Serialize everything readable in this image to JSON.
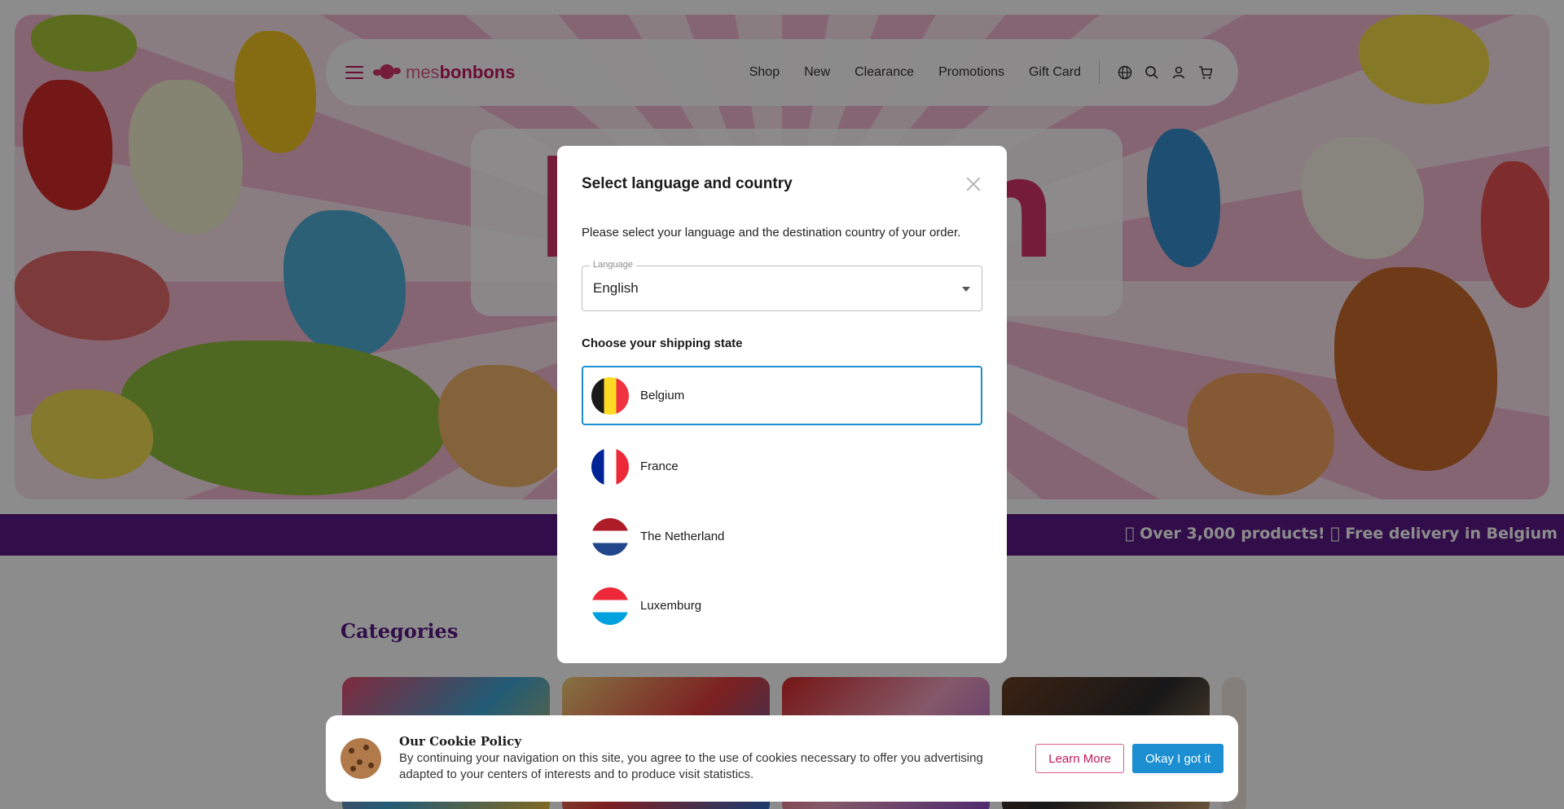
{
  "header": {
    "logo_prefix": "mes",
    "logo_suffix": "bonbons",
    "nav": [
      {
        "label": "Shop"
      },
      {
        "label": "New"
      },
      {
        "label": "Clearance"
      },
      {
        "label": "Promotions"
      },
      {
        "label": "Gift Card"
      }
    ],
    "icons": [
      "globe-icon",
      "search-icon",
      "user-icon",
      "cart-icon"
    ]
  },
  "hero": {
    "title": "Pick 'n Mix!"
  },
  "marquee": {
    "text": "\u0000 Over 3,000 products! \u0000 Free delivery in Belgium"
  },
  "categories": {
    "title": "Categories"
  },
  "modal": {
    "title": "Select language and country",
    "description": "Please select your language and the destination country of your order.",
    "language_label": "Language",
    "language_value": "English",
    "shipping_title": "Choose your shipping state",
    "countries": [
      {
        "label": "Belgium",
        "selected": true,
        "flag": [
          "#1a1a1a",
          "#fdda24",
          "#ef3340"
        ]
      },
      {
        "label": "France",
        "selected": false,
        "flag": [
          "#002395",
          "#ffffff",
          "#ed2939"
        ]
      },
      {
        "label": "The Netherland",
        "selected": false,
        "flag": [
          "#ae1c28",
          "#ffffff",
          "#21468b"
        ]
      },
      {
        "label": "Luxemburg",
        "selected": false,
        "flag": [
          "#ed2939",
          "#ffffff",
          "#00a1de"
        ]
      }
    ]
  },
  "cookie": {
    "title": "Our Cookie Policy",
    "body": "By continuing your navigation on this site, you agree to the use of cookies necessary to offer you advertising adapted to your centers of interests and to produce visit statistics.",
    "learn_more": "Learn More",
    "ok": "Okay I got it"
  },
  "colors": {
    "brand": "#c2185b",
    "marquee": "#5a1a86",
    "accent_blue": "#1b8fd1"
  }
}
